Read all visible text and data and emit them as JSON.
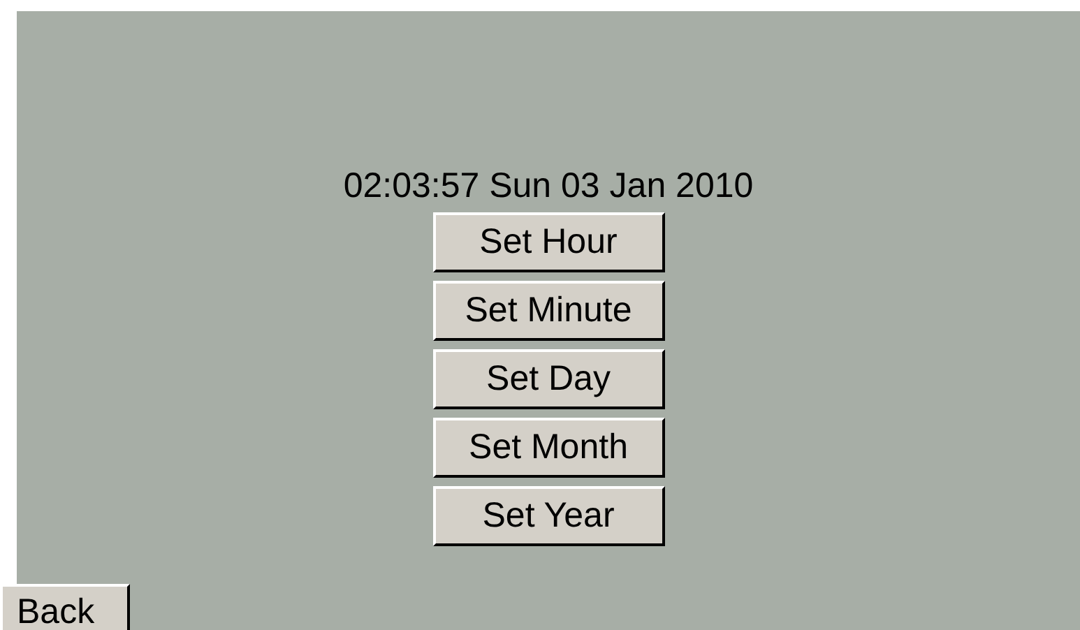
{
  "datetime": "02:03:57 Sun 03 Jan 2010",
  "buttons": [
    "Set Hour",
    "Set Minute",
    "Set Day",
    "Set Month",
    "Set Year"
  ],
  "back_button": "Back"
}
